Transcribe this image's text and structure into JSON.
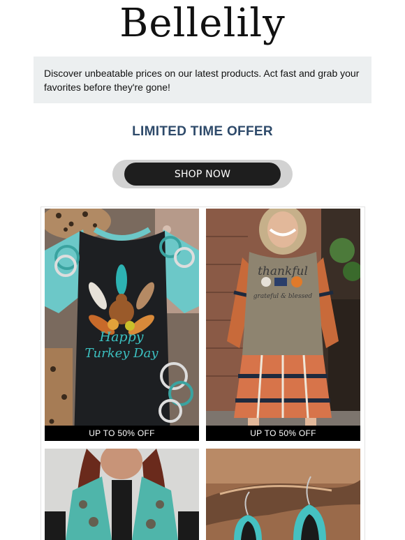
{
  "brand": {
    "name": "Bellelily"
  },
  "banner": {
    "text": "Discover unbeatable prices on our latest products. Act fast and grab your favorites before they're gone!"
  },
  "promo": {
    "headline": "LIMITED TIME OFFER",
    "cta_label": "SHOP NOW"
  },
  "products": [
    {
      "caption": "UP TO 50% OFF",
      "print_line1": "Happy",
      "print_line2": "Turkey Day",
      "image": "turkey-raglan-tee"
    },
    {
      "caption": "UP TO 50% OFF",
      "print_line1": "thankful",
      "print_line2": "grateful & blessed",
      "image": "plaid-thankful-dress"
    },
    {
      "caption": "",
      "image": "turquoise-paisley-vest"
    },
    {
      "caption": "",
      "image": "turquoise-leather-earrings"
    }
  ],
  "colors": {
    "headline": "#2e4a6a",
    "banner_bg": "#eceff0",
    "button": "#1e1e1e",
    "button_ring": "#d2d2d2"
  }
}
